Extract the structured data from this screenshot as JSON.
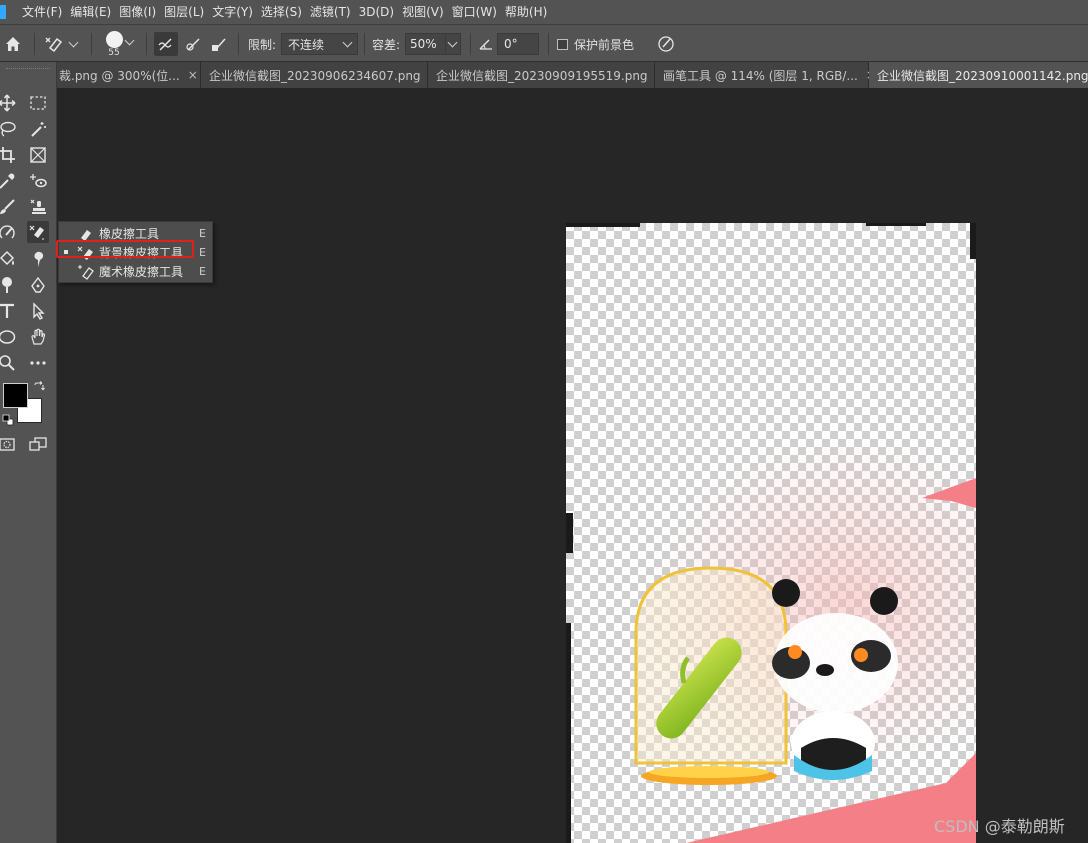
{
  "menubar": {
    "items": [
      "文件(F)",
      "编辑(E)",
      "图像(I)",
      "图层(L)",
      "文字(Y)",
      "选择(S)",
      "滤镜(T)",
      "3D(D)",
      "视图(V)",
      "窗口(W)",
      "帮助(H)"
    ]
  },
  "options": {
    "brush_size": "55",
    "limit_label": "限制:",
    "limit_value": "不连续",
    "tolerance_label": "容差:",
    "tolerance_value": "50%",
    "angle_value": "0°",
    "protect_fg_label": "保护前景色"
  },
  "tabs": [
    {
      "label": "裁.png @ 300%(位..."
    },
    {
      "label": "企业微信截图_20230906234607.png"
    },
    {
      "label": "企业微信截图_20230909195519.png"
    },
    {
      "label": "画笔工具 @ 114% (图层 1, RGB/..."
    },
    {
      "label": "企业微信截图_20230910001142.png"
    }
  ],
  "tab_close": "×",
  "flyout": {
    "items": [
      {
        "label": "橡皮擦工具",
        "key": "E",
        "selected": false
      },
      {
        "label": "背景橡皮擦工具",
        "key": "E",
        "selected": true
      },
      {
        "label": "魔术橡皮擦工具",
        "key": "E",
        "selected": false
      }
    ]
  },
  "watermark": "CSDN @泰勒朗斯",
  "colors": {
    "foreground": "#000000",
    "background": "#ffffff",
    "highlight": "#e0201c"
  }
}
